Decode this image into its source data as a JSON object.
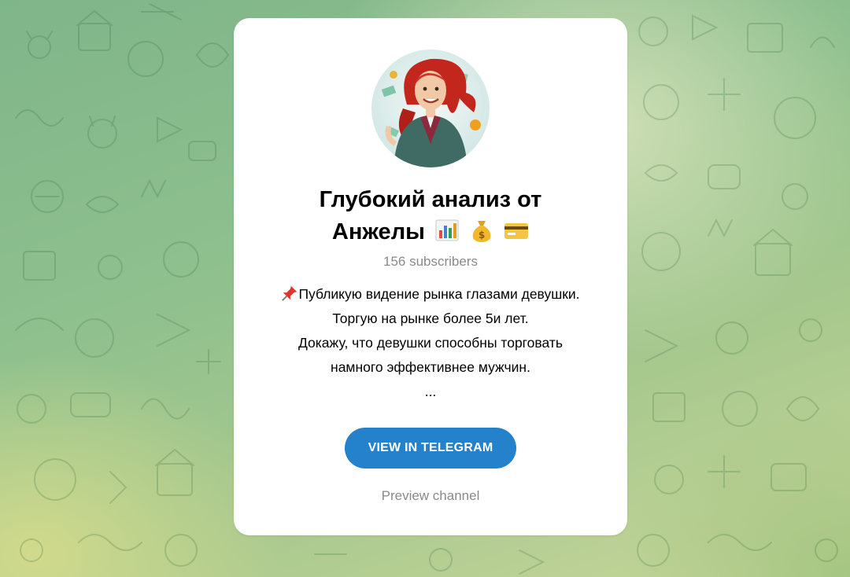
{
  "channel": {
    "title_line1": "Глубокий анализ от",
    "title_line2": "Анжелы",
    "title_emojis": [
      "bar-chart-icon",
      "money-bag-icon",
      "credit-card-icon"
    ],
    "subscribers": "156 subscribers",
    "description": [
      "Публикую видение рынка глазами девушки.",
      "Торгую на рынке более 5и лет.",
      "Докажу, что девушки способны торговать",
      "намного эффективнее мужчин.",
      "..."
    ],
    "description_prefix_icon": "pushpin-icon"
  },
  "actions": {
    "view_label": "VIEW IN TELEGRAM",
    "preview_label": "Preview channel"
  },
  "colors": {
    "button": "#2481cc",
    "muted_text": "#8a8a8a",
    "background_green": "#8fc08e"
  }
}
